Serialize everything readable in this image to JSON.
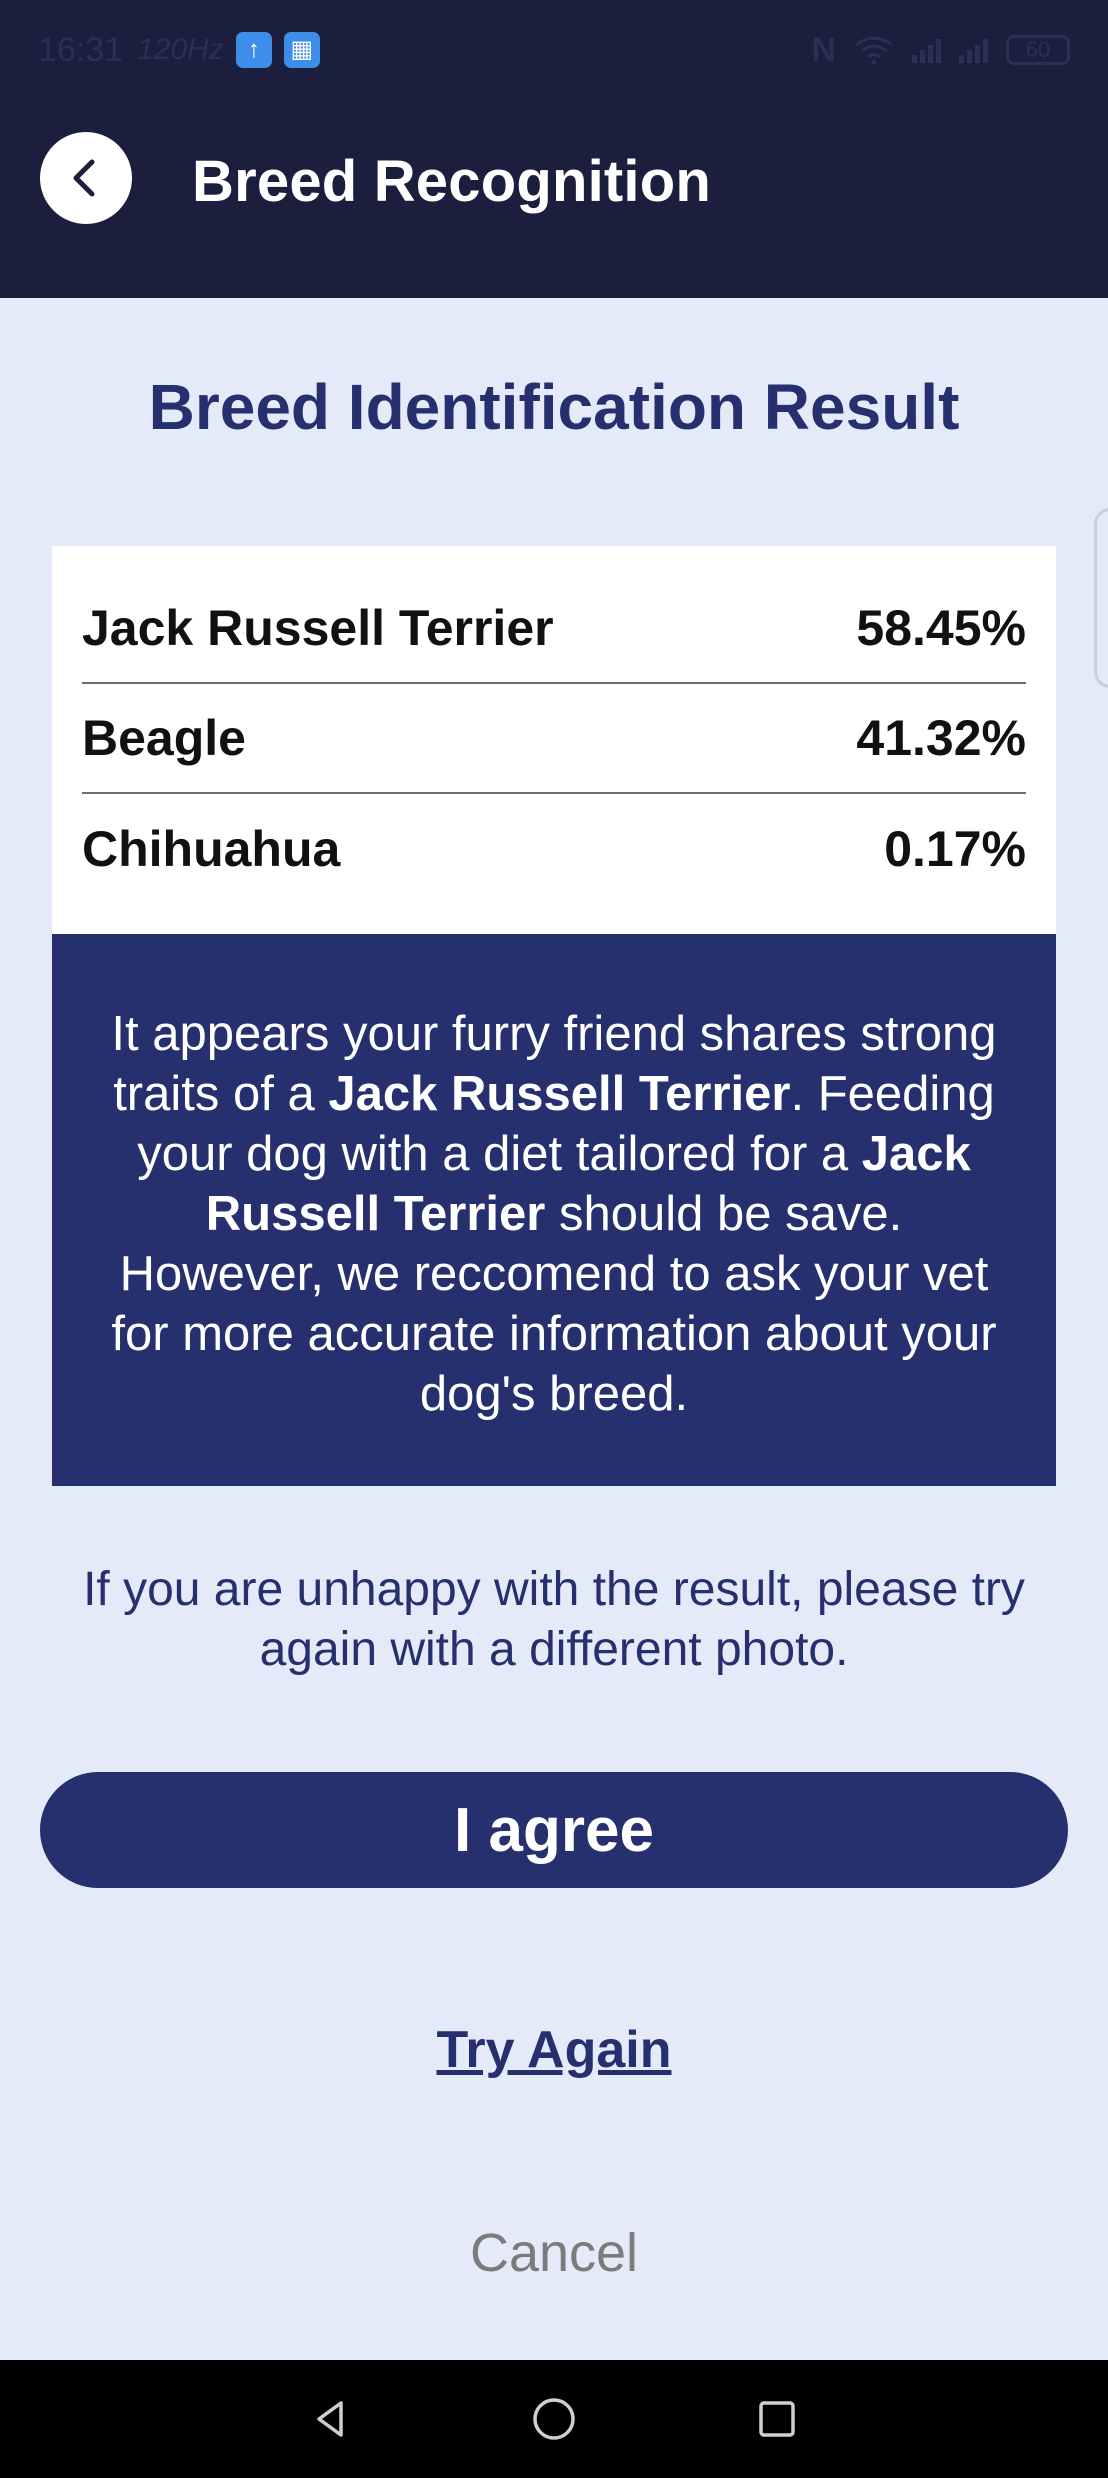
{
  "status_bar": {
    "time": "16:31",
    "refresh_rate": "120Hz",
    "battery": "60",
    "icons": [
      "upload-app-icon",
      "calendar-app-icon",
      "nfc-icon",
      "wifi-icon",
      "signal-icon",
      "signal-roaming-icon",
      "battery-icon"
    ]
  },
  "app_bar": {
    "title": "Breed Recognition",
    "back_icon": "chevron-left-icon"
  },
  "heading": "Breed Identification Result",
  "results": [
    {
      "breed": "Jack Russell Terrier",
      "percent": "58.45%"
    },
    {
      "breed": "Beagle",
      "percent": "41.32%"
    },
    {
      "breed": "Chihuahua",
      "percent": "0.17%"
    }
  ],
  "info": {
    "part1": "It appears your furry friend shares strong traits of a ",
    "breed_bold_1": "Jack Russell Terrier",
    "part2": ". Feeding your dog with a diet tailored for a ",
    "breed_bold_2": "Jack Russell Terrier",
    "part3": " should be save. However, we reccomend to ask your vet for more accurate information about your dog's breed."
  },
  "note": "If you are unhappy with the result, please try again with a different photo.",
  "buttons": {
    "agree": "I agree",
    "try_again": "Try Again",
    "cancel": "Cancel"
  },
  "colors": {
    "primary": "#27306e",
    "topbar": "#1b1e3d",
    "background": "#e4eaf8",
    "muted": "#7b7b7b"
  },
  "nav_bar": {
    "icons": [
      "back-triangle-icon",
      "home-circle-icon",
      "recents-square-icon"
    ]
  }
}
